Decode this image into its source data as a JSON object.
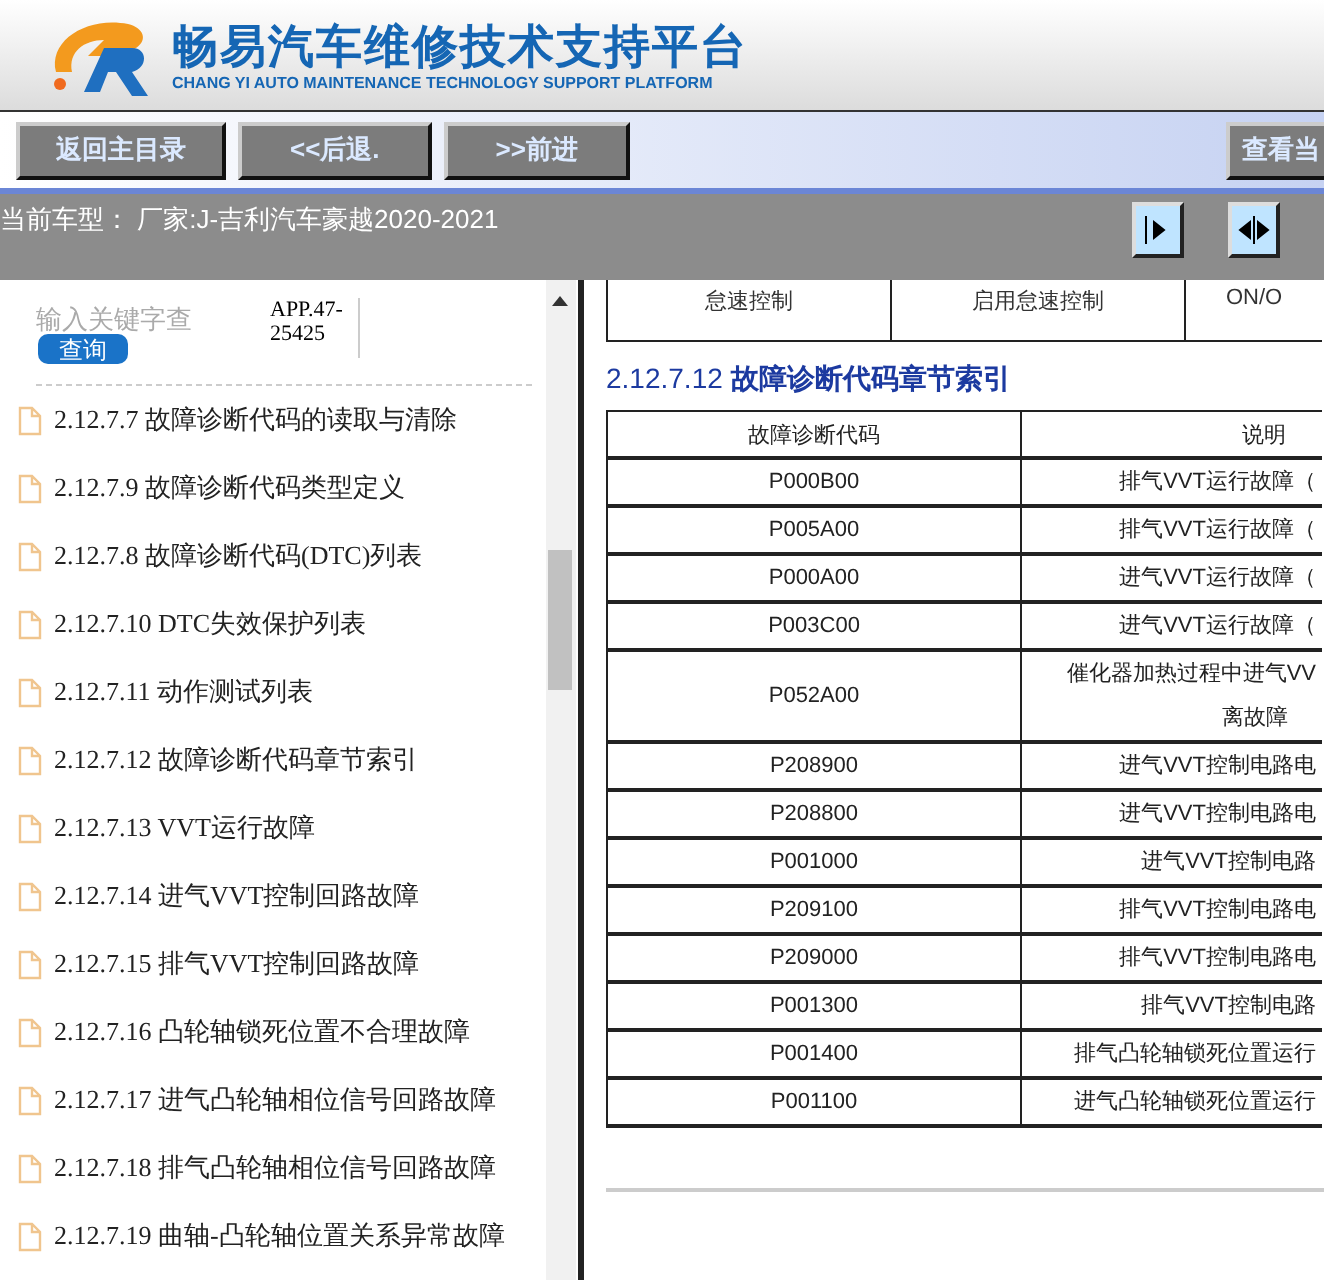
{
  "header": {
    "title": "畅易汽车维修技术支持平台",
    "subtitle": "CHANG YI AUTO MAINTENANCE TECHNOLOGY SUPPORT PLATFORM"
  },
  "toolbar": {
    "buttons": [
      "返回主目录",
      "<<后退.",
      ">>前进"
    ],
    "right_button": "查看当"
  },
  "vehicle_bar": {
    "text": "当前车型： 厂家:J-吉利汽车豪越2020-2021"
  },
  "sidebar": {
    "search": {
      "placeholder": "输入关键字查",
      "button": "查询",
      "code": "APP.47-25425"
    },
    "items": [
      {
        "label": "2.12.7.7 故障诊断代码的读取与清除"
      },
      {
        "label": "2.12.7.9 故障诊断代码类型定义"
      },
      {
        "label": "2.12.7.8 故障诊断代码(DTC)列表"
      },
      {
        "label": "2.12.7.10 DTC失效保护列表"
      },
      {
        "label": "2.12.7.11 动作测试列表"
      },
      {
        "label": "2.12.7.12 故障诊断代码章节索引"
      },
      {
        "label": "2.12.7.13 VVT运行故障"
      },
      {
        "label": "2.12.7.14 进气VVT控制回路故障"
      },
      {
        "label": "2.12.7.15 排气VVT控制回路故障"
      },
      {
        "label": "2.12.7.16 凸轮轴锁死位置不合理故障"
      },
      {
        "label": "2.12.7.17 进气凸轮轴相位信号回路故障"
      },
      {
        "label": "2.12.7.18 排气凸轮轴相位信号回路故障"
      },
      {
        "label": "2.12.7.19 曲轴-凸轮轴位置关系异常故障"
      }
    ]
  },
  "content": {
    "top_table": {
      "cells": [
        "怠速控制",
        "启用怠速控制",
        "ON/O"
      ]
    },
    "heading": "2.12.7.12 **故障诊断代码章节索引**",
    "table": {
      "columns": [
        "故障诊断代码",
        "说明"
      ],
      "rows": [
        {
          "code": "P000B00",
          "description": [
            "排气VVT运行故障（"
          ]
        },
        {
          "code": "P005A00",
          "description": [
            "排气VVT运行故障（"
          ]
        },
        {
          "code": "P000A00",
          "description": [
            "进气VVT运行故障（"
          ]
        },
        {
          "code": "P003C00",
          "description": [
            "进气VVT运行故障（"
          ]
        },
        {
          "code": "P052A00",
          "description": [
            "催化器加热过程中进气VV",
            "离故障"
          ]
        },
        {
          "code": "P208900",
          "description": [
            "进气VVT控制电路电"
          ]
        },
        {
          "code": "P208800",
          "description": [
            "进气VVT控制电路电"
          ]
        },
        {
          "code": "P001000",
          "description": [
            "进气VVT控制电路"
          ]
        },
        {
          "code": "P209100",
          "description": [
            "排气VVT控制电路电"
          ]
        },
        {
          "code": "P209000",
          "description": [
            "排气VVT控制电路电"
          ]
        },
        {
          "code": "P001300",
          "description": [
            "排气VVT控制电路"
          ]
        },
        {
          "code": "P001400",
          "description": [
            "排气凸轮轴锁死位置运行"
          ]
        },
        {
          "code": "P001100",
          "description": [
            "进气凸轮轴锁死位置运行"
          ]
        }
      ]
    }
  }
}
